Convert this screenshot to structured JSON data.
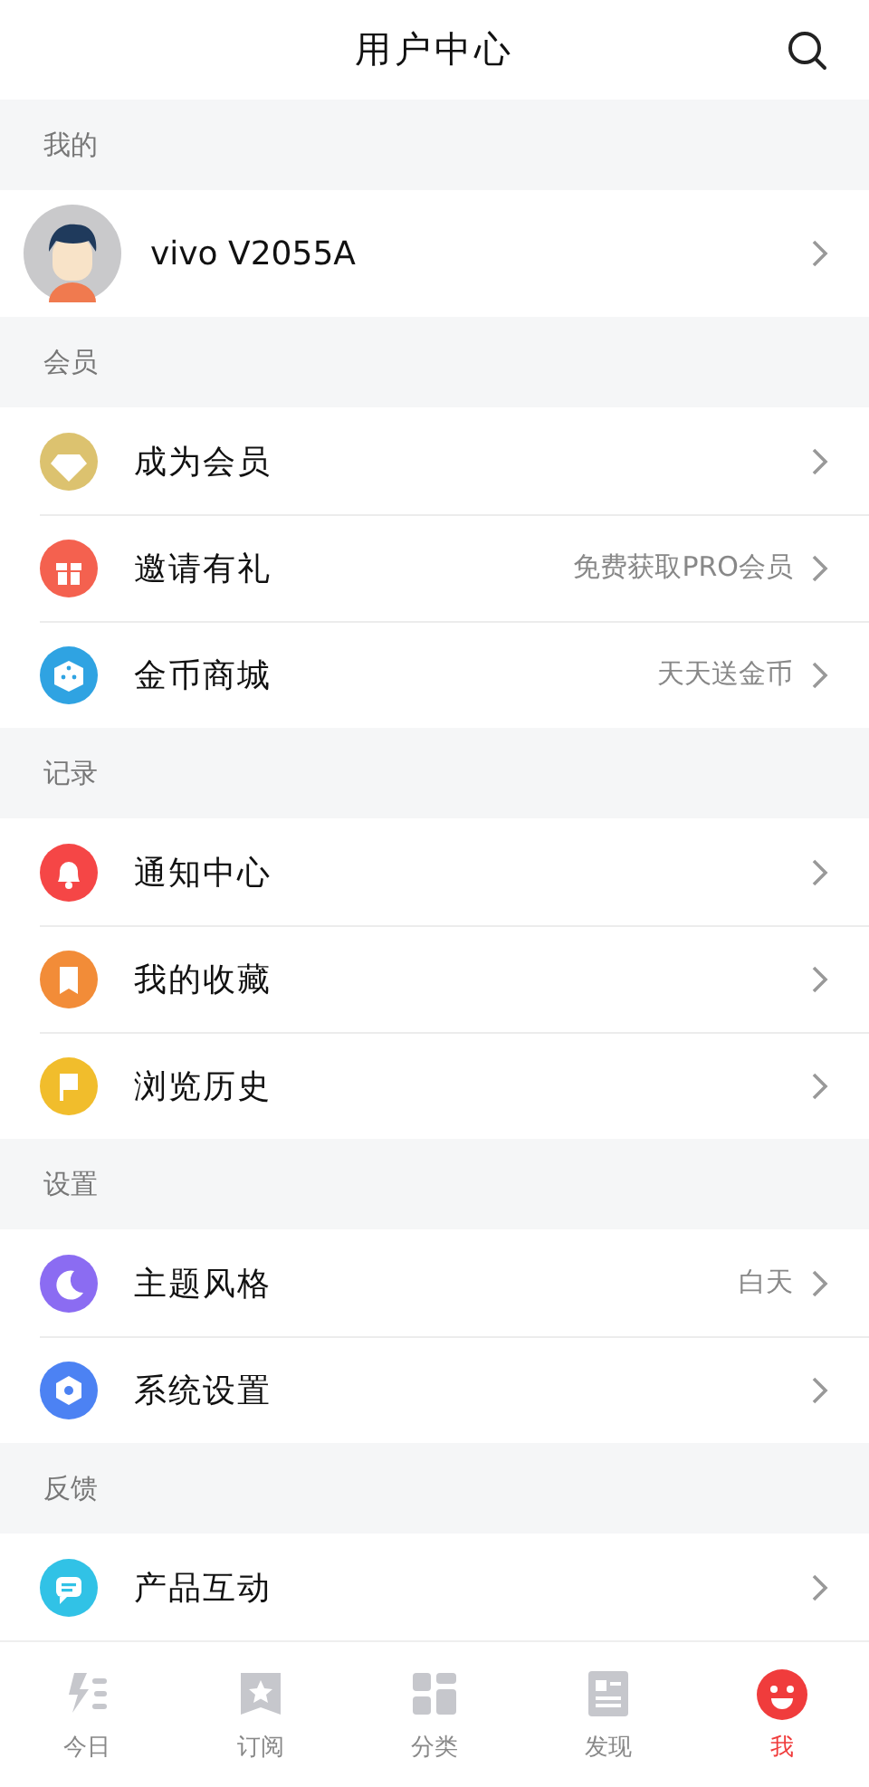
{
  "header": {
    "title": "用户中心"
  },
  "sections": [
    {
      "title": "我的",
      "items": [
        {
          "kind": "profile",
          "label": "vivo V2055A"
        }
      ]
    },
    {
      "title": "会员",
      "items": [
        {
          "kind": "link",
          "color": "#dcc26f",
          "label": "成为会员"
        },
        {
          "kind": "link",
          "color": "#f4614f",
          "label": "邀请有礼",
          "value": "免费获取PRO会员"
        },
        {
          "kind": "link",
          "color": "#2fa3e2",
          "label": "金币商城",
          "value": "天天送金币"
        }
      ]
    },
    {
      "title": "记录",
      "items": [
        {
          "kind": "link",
          "color": "#f54646",
          "label": "通知中心"
        },
        {
          "kind": "link",
          "color": "#f28c38",
          "label": "我的收藏"
        },
        {
          "kind": "link",
          "color": "#f1bd2c",
          "label": "浏览历史"
        }
      ]
    },
    {
      "title": "设置",
      "items": [
        {
          "kind": "link",
          "color": "#8b6cf2",
          "label": "主题风格",
          "value": "白天"
        },
        {
          "kind": "link",
          "color": "#4c82f3",
          "label": "系统设置"
        }
      ]
    },
    {
      "title": "反馈",
      "items": [
        {
          "kind": "link",
          "color": "#31c2e6",
          "label": "产品互动"
        }
      ]
    }
  ],
  "tabs": [
    {
      "label": "今日",
      "selected": false
    },
    {
      "label": "订阅",
      "selected": false
    },
    {
      "label": "分类",
      "selected": false
    },
    {
      "label": "发现",
      "selected": false
    },
    {
      "label": "我",
      "selected": true
    }
  ]
}
